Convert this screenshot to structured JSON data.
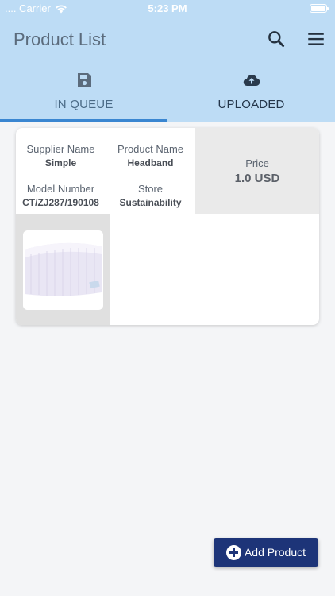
{
  "status_bar": {
    "carrier": ".... Carrier",
    "time": "5:23 PM"
  },
  "header": {
    "title": "Product List",
    "icons": [
      "search-icon",
      "menu-icon"
    ]
  },
  "tabs": [
    {
      "label": "IN QUEUE",
      "icon": "save-icon",
      "active": true
    },
    {
      "label": "UPLOADED",
      "icon": "cloud-upload-icon",
      "active": false
    }
  ],
  "product": {
    "supplier_label": "Supplier Name",
    "supplier_value": "Simple",
    "product_label": "Product Name",
    "product_value": "Headband",
    "model_label": "Model Number",
    "model_value": "CT/ZJ287/190108",
    "store_label": "Store",
    "store_value": "Sustainability",
    "price_label": "Price",
    "price_value": "1.0 USD",
    "image": "headband-photo"
  },
  "fab": {
    "label": "Add Product",
    "icon": "add-circle-icon"
  },
  "colors": {
    "header_bg": "#bddcf5",
    "tab_indicator": "#3a86d1",
    "fab_bg": "#1d3478"
  }
}
